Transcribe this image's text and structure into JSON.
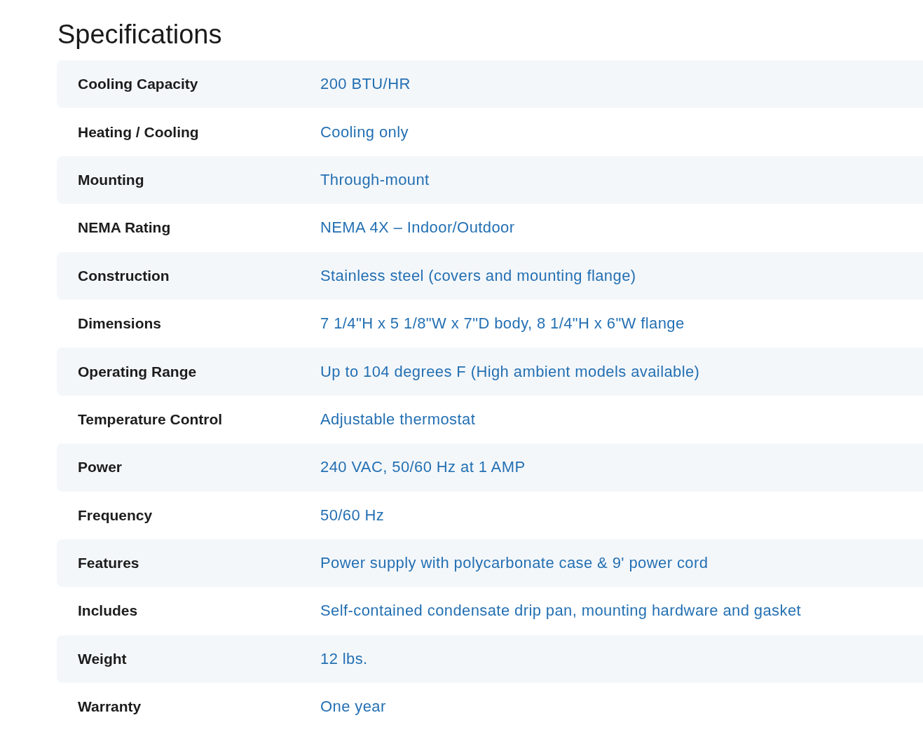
{
  "title": "Specifications",
  "rows": [
    {
      "label": "Cooling Capacity",
      "value": "200 BTU/HR"
    },
    {
      "label": "Heating / Cooling",
      "value": "Cooling only"
    },
    {
      "label": "Mounting",
      "value": "Through-mount"
    },
    {
      "label": "NEMA Rating",
      "value": "NEMA 4X – Indoor/Outdoor"
    },
    {
      "label": "Construction",
      "value": "Stainless steel (covers and mounting flange)"
    },
    {
      "label": "Dimensions",
      "value": "7 1/4\"H x 5 1/8\"W x 7\"D body, 8 1/4\"H x 6\"W flange"
    },
    {
      "label": "Operating Range",
      "value": "Up to 104 degrees F (High ambient models available)"
    },
    {
      "label": "Temperature Control",
      "value": "Adjustable thermostat"
    },
    {
      "label": "Power",
      "value": "240 VAC, 50/60 Hz at 1 AMP"
    },
    {
      "label": "Frequency",
      "value": "50/60 Hz"
    },
    {
      "label": "Features",
      "value": "Power supply with polycarbonate case & 9' power cord"
    },
    {
      "label": "Includes",
      "value": "Self-contained condensate drip pan, mounting hardware and gasket"
    },
    {
      "label": "Weight",
      "value": "12 lbs."
    },
    {
      "label": "Warranty",
      "value": "One year"
    }
  ]
}
